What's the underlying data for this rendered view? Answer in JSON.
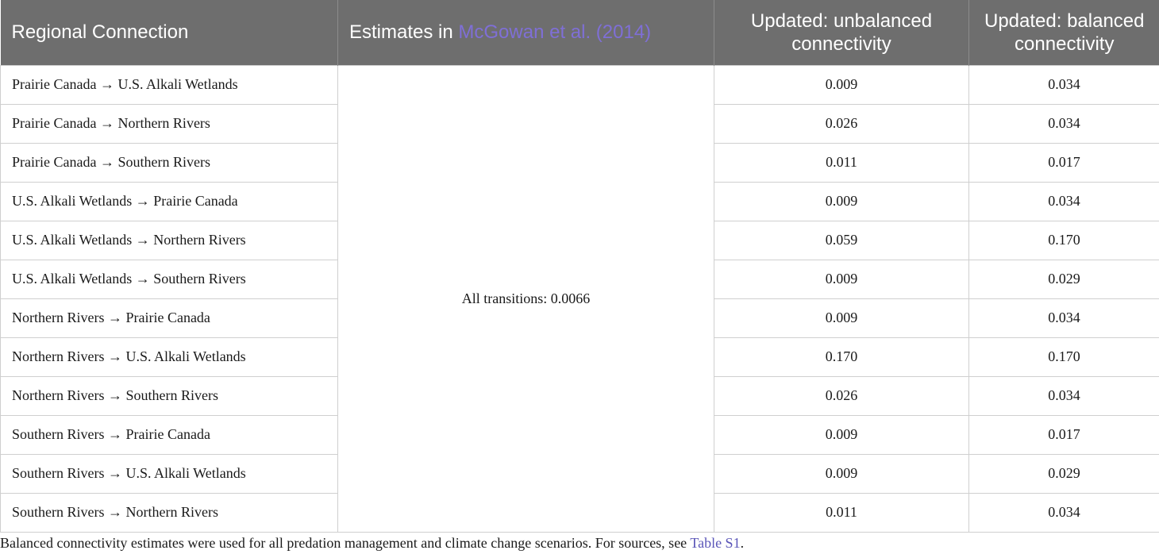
{
  "header": {
    "col1": "Regional Connection",
    "col2_prefix": "Estimates in ",
    "col2_ref": "McGowan et al. (2014)",
    "col3": "Updated: unbalanced connectivity",
    "col4": "Updated: balanced connectivity"
  },
  "merged_cell": "All transitions: 0.0066",
  "rows": [
    {
      "connection": "Prairie Canada → U.S. Alkali Wetlands",
      "unbalanced": "0.009",
      "balanced": "0.034"
    },
    {
      "connection": "Prairie Canada → Northern Rivers",
      "unbalanced": "0.026",
      "balanced": "0.034"
    },
    {
      "connection": "Prairie Canada → Southern Rivers",
      "unbalanced": "0.011",
      "balanced": "0.017"
    },
    {
      "connection": "U.S. Alkali Wetlands → Prairie Canada",
      "unbalanced": "0.009",
      "balanced": "0.034"
    },
    {
      "connection": "U.S. Alkali Wetlands → Northern Rivers",
      "unbalanced": "0.059",
      "balanced": "0.170"
    },
    {
      "connection": "U.S. Alkali Wetlands → Southern Rivers",
      "unbalanced": "0.009",
      "balanced": "0.029"
    },
    {
      "connection": "Northern Rivers → Prairie Canada",
      "unbalanced": "0.009",
      "balanced": "0.034"
    },
    {
      "connection": "Northern Rivers → U.S. Alkali Wetlands",
      "unbalanced": "0.170",
      "balanced": "0.170"
    },
    {
      "connection": "Northern Rivers → Southern Rivers",
      "unbalanced": "0.026",
      "balanced": "0.034"
    },
    {
      "connection": "Southern Rivers → Prairie Canada",
      "unbalanced": "0.009",
      "balanced": "0.017"
    },
    {
      "connection": "Southern Rivers → U.S. Alkali Wetlands",
      "unbalanced": "0.009",
      "balanced": "0.029"
    },
    {
      "connection": "Southern Rivers → Northern Rivers",
      "unbalanced": "0.011",
      "balanced": "0.034"
    }
  ],
  "footnote": {
    "text": "Balanced connectivity estimates were used for all predation management and climate change scenarios. For sources, see ",
    "link": "Table S1",
    "end": "."
  }
}
